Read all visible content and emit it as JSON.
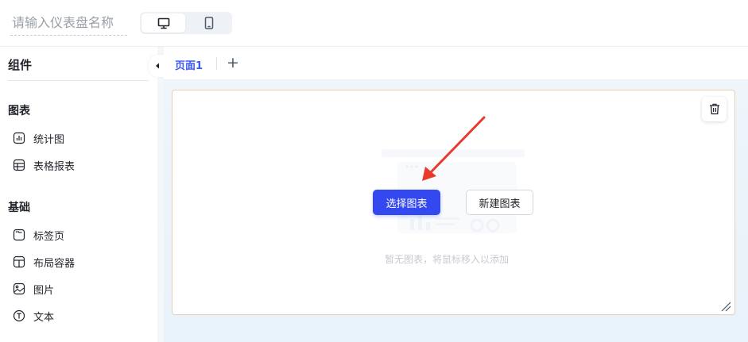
{
  "header": {
    "name_placeholder": "请输入仪表盘名称",
    "device_toggle": [
      {
        "icon": "desktop-icon",
        "active": true
      },
      {
        "icon": "mobile-icon",
        "active": false
      }
    ]
  },
  "sidebar": {
    "title": "组件",
    "groups": [
      {
        "label": "图表",
        "items": [
          {
            "label": "统计图",
            "icon": "bar-chart-icon"
          },
          {
            "label": "表格报表",
            "icon": "table-icon"
          }
        ]
      },
      {
        "label": "基础",
        "items": [
          {
            "label": "标签页",
            "icon": "tabs-icon"
          },
          {
            "label": "布局容器",
            "icon": "layout-icon"
          },
          {
            "label": "图片",
            "icon": "image-icon"
          },
          {
            "label": "文本",
            "icon": "text-icon"
          }
        ]
      }
    ]
  },
  "tabs": {
    "items": [
      {
        "label": "页面1",
        "active": true
      }
    ],
    "add_label": "+"
  },
  "canvas": {
    "select_chart_label": "选择图表",
    "new_chart_label": "新建图表",
    "empty_text": "暂无图表，将鼠标移入以添加"
  },
  "colors": {
    "accent": "#3448f0",
    "tab_active": "#3b57f5",
    "annotation_arrow": "#e8392c",
    "card_border": "#e9cfb4"
  }
}
